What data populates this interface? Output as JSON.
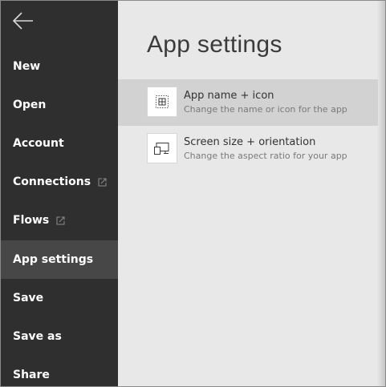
{
  "sidebar": {
    "back_icon": "arrow-left-icon",
    "items": [
      {
        "label": "New",
        "external": false,
        "selected": false
      },
      {
        "label": "Open",
        "external": false,
        "selected": false
      },
      {
        "label": "Account",
        "external": false,
        "selected": false
      },
      {
        "label": "Connections",
        "external": true,
        "selected": false
      },
      {
        "label": "Flows",
        "external": true,
        "selected": false
      },
      {
        "label": "App settings",
        "external": false,
        "selected": true
      },
      {
        "label": "Save",
        "external": false,
        "selected": false
      },
      {
        "label": "Save as",
        "external": false,
        "selected": false
      },
      {
        "label": "Share",
        "external": false,
        "selected": false
      }
    ]
  },
  "main": {
    "title": "App settings",
    "items": [
      {
        "title": "App name + icon",
        "description": "Change the name or icon for the app",
        "icon": "app-grid-icon",
        "selected": true
      },
      {
        "title": "Screen size + orientation",
        "description": "Change the aspect ratio for your app",
        "icon": "screen-devices-icon",
        "selected": false
      }
    ]
  },
  "colors": {
    "sidebar_bg": "#2f2f2f",
    "sidebar_selected_bg": "#474747",
    "content_bg": "#e8e8e8",
    "item_selected_bg": "#d2d2d2"
  }
}
